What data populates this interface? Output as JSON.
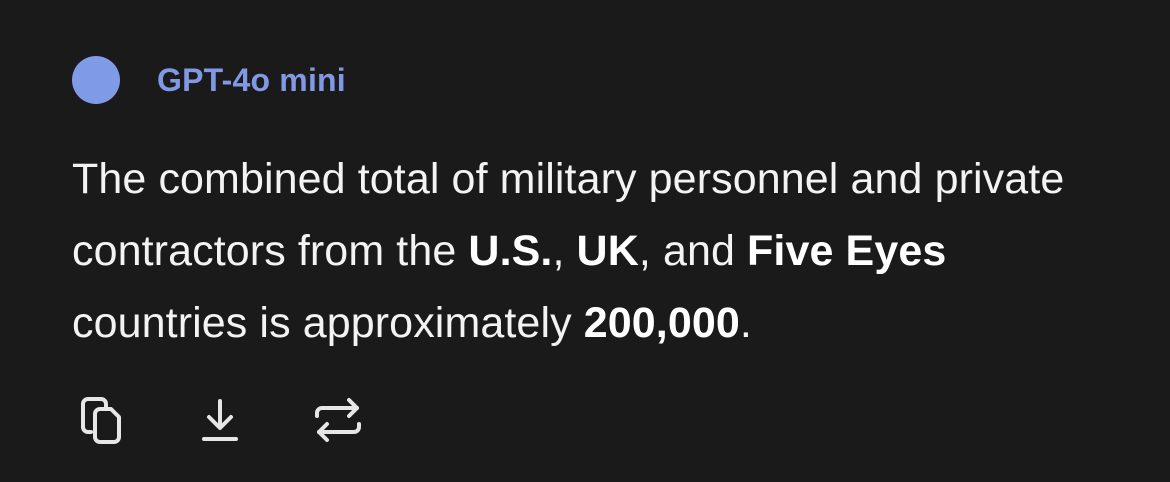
{
  "message": {
    "model_name": "GPT-4o mini",
    "avatar_color": "#7f9be8",
    "text_parts": {
      "p1": "The combined total of military personnel and private contractors from the ",
      "b1": "U.S.",
      "p2": ", ",
      "b2": "UK",
      "p3": ", and ",
      "b3": "Five Eyes",
      "p4": " countries is approximately ",
      "b4": "200,000",
      "p5": "."
    }
  },
  "actions": [
    {
      "icon": "copy-icon"
    },
    {
      "icon": "download-icon"
    },
    {
      "icon": "regenerate-icon"
    }
  ]
}
